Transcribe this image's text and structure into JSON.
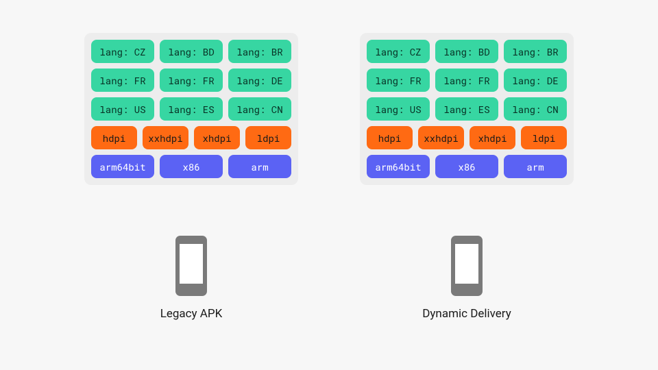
{
  "left": {
    "caption": "Legacy APK",
    "lang_rows": [
      [
        "lang: CZ",
        "lang: BD",
        "lang: BR"
      ],
      [
        "lang: FR",
        "lang: FR",
        "lang: DE"
      ],
      [
        "lang: US",
        "lang: ES",
        "lang: CN"
      ]
    ],
    "dpi_row": [
      "hdpi",
      "xxhdpi",
      "xhdpi",
      "ldpi"
    ],
    "arch_row": [
      "arm64bit",
      "x86",
      "arm"
    ]
  },
  "right": {
    "caption": "Dynamic Delivery",
    "lang_rows": [
      [
        "lang: CZ",
        "lang: BD",
        "lang: BR"
      ],
      [
        "lang: FR",
        "lang: FR",
        "lang: DE"
      ],
      [
        "lang: US",
        "lang: ES",
        "lang: CN"
      ]
    ],
    "dpi_row": [
      "hdpi",
      "xxhdpi",
      "xhdpi",
      "ldpi"
    ],
    "arch_row": [
      "arm64bit",
      "x86",
      "arm"
    ]
  },
  "colors": {
    "lang": "#37d6a2",
    "dpi": "#ff6a13",
    "arch": "#5b62f4",
    "card": "#ededed",
    "bg": "#f7f7f7"
  }
}
